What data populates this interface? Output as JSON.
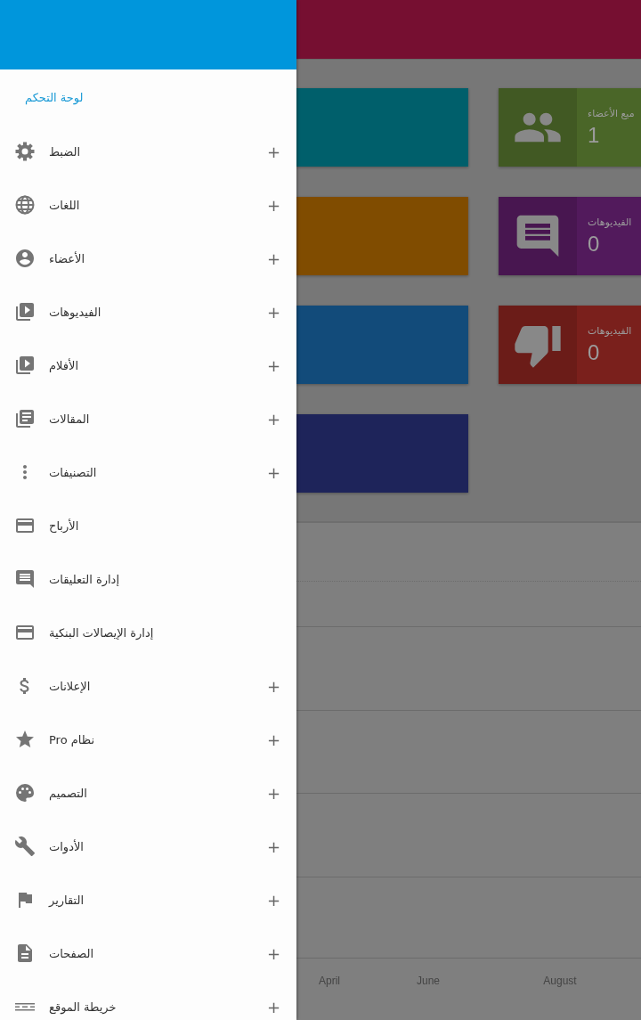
{
  "drawer": {
    "title": "لوحة التحكم",
    "items": [
      {
        "label": "الضبط",
        "toggle": "+"
      },
      {
        "label": "اللغات",
        "toggle": "+"
      },
      {
        "label": "الأعضاء",
        "toggle": "+"
      },
      {
        "label": "الفيديوهات",
        "toggle": "+"
      },
      {
        "label": "الأفلام",
        "toggle": "+"
      },
      {
        "label": "المقالات",
        "toggle": "+"
      },
      {
        "label": "التصنيفات",
        "toggle": "+"
      },
      {
        "label": "الأرباح"
      },
      {
        "label": "إدارة التعليقات"
      },
      {
        "label": "إدارة الإيصالات البنكية"
      },
      {
        "label": "الإعلانات",
        "toggle": "+"
      },
      {
        "label": "نظام Pro",
        "toggle": "+"
      },
      {
        "label": "التصميم",
        "toggle": "+"
      },
      {
        "label": "الأدوات",
        "toggle": "+"
      },
      {
        "label": "التقارير",
        "toggle": "+"
      },
      {
        "label": "الصفحات",
        "toggle": "+"
      },
      {
        "label": "خريطة الموقع",
        "toggle": "+"
      }
    ]
  },
  "dashboard": {
    "left_cards": [
      {
        "color": "#005f6b"
      },
      {
        "color": "#804c00"
      },
      {
        "color": "#124b7a"
      },
      {
        "color": "#1e245a"
      }
    ],
    "right_cards": [
      {
        "label": "ميع الأعضاء",
        "value": "1",
        "color": "#4a6628"
      },
      {
        "label": "الفيديوهات",
        "value": "0",
        "color": "#521a5c"
      },
      {
        "label": "الفيديوهات",
        "value": "0",
        "color": "#7a201c"
      }
    ],
    "chart_x_labels": [
      "August",
      "June",
      "April"
    ]
  }
}
